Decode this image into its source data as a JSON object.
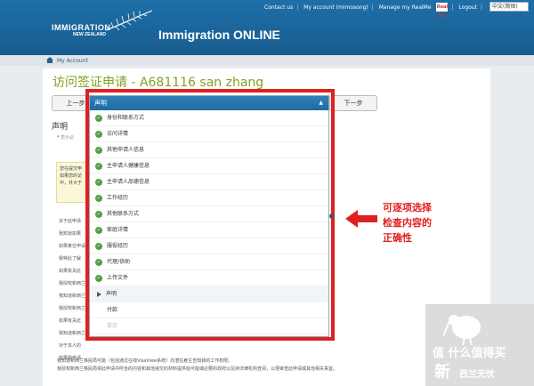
{
  "header": {
    "brand_line1": "IMMIGRATION",
    "brand_line2": "NEW ZEALAND",
    "app_title": "Immigration ONLINE",
    "nav": {
      "contact": "Contact us",
      "account": "My account (mimosong)",
      "realme": "Manage my RealMe",
      "realme_badge": "Real me",
      "logout": "Logout",
      "language": "中文(简体)"
    }
  },
  "breadcrumb": {
    "label": "My Account"
  },
  "page": {
    "title": "访问签证申请 - A681116 san zhang",
    "prev_button": "上一步",
    "next_button": "下一步",
    "section_title": "声明",
    "required_note": "表示必"
  },
  "info_box": {
    "line1": "您在提交申",
    "line2": "如果您的访",
    "line3": "中，并大于"
  },
  "body_lines": [
    "关于此申请",
    "我知道如果",
    "如果某位申请",
    "我特此了解",
    "如果有关此",
    "我授权新西兰",
    "我知道新西兰",
    "我授权新西兰",
    "如果有关此",
    "我知道新西兰",
    "对于本人的",
    "如果我申请"
  ],
  "footer_text": {
    "line1": "我知道新西兰移民局可能（包括通过在线VisaView系统）向潜在雇主告知我的工作权限。",
    "line2": "我授权新西兰移民局将此申请中所含的内容和其他递交的材料提供给可能或必要的政府以及持法律机构查阅，以便审查此申请或其他相关事宜。"
  },
  "dropdown": {
    "header": "声明",
    "items": [
      {
        "label": "身份和联系方式",
        "status": "complete"
      },
      {
        "label": "访问详情",
        "status": "complete"
      },
      {
        "label": "其他申请人信息",
        "status": "complete"
      },
      {
        "label": "主申请人健康信息",
        "status": "complete"
      },
      {
        "label": "主申请人品德信息",
        "status": "complete"
      },
      {
        "label": "工作经历",
        "status": "complete"
      },
      {
        "label": "其他联系方式",
        "status": "complete"
      },
      {
        "label": "家庭详情",
        "status": "complete"
      },
      {
        "label": "服役经历",
        "status": "complete"
      },
      {
        "label": "代理/协助",
        "status": "complete"
      },
      {
        "label": "上传文件",
        "status": "complete"
      },
      {
        "label": "声明",
        "status": "current"
      },
      {
        "label": "付款",
        "status": "none"
      },
      {
        "label": "提交",
        "status": "faded"
      }
    ]
  },
  "annotation": {
    "line1": "可逐项选择",
    "line2": "检查内容的",
    "line3": "正确性"
  },
  "watermark": {
    "t1": "值 什么值得买",
    "t2": "新",
    "t3": "西兰无忧"
  },
  "colors": {
    "header_blue": "#1e6fa8",
    "title_green": "#7fa320",
    "highlight_red": "#e02020",
    "check_green": "#4aa43a"
  }
}
